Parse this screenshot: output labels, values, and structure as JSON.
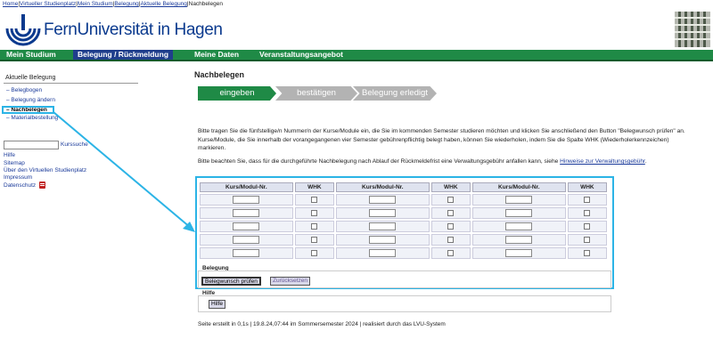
{
  "breadcrumb": {
    "items": [
      "Home",
      "Virtueller Studienplatz",
      "Mein Studium",
      "Belegung",
      "Aktuelle Belegung"
    ],
    "current": "Nachbelegen"
  },
  "header": {
    "logo_text": "FernUniversität in Hagen"
  },
  "topnav": {
    "items": [
      {
        "label": "Mein Studium",
        "active": false
      },
      {
        "label": "Belegung / Rückmeldung",
        "active": true
      },
      {
        "label": "Meine Daten",
        "active": false
      },
      {
        "label": "Veranstaltungsangebot",
        "active": false
      }
    ]
  },
  "sidebar": {
    "title": "Aktuelle Belegung",
    "items": [
      {
        "label": "– Belegbogen"
      },
      {
        "label": "– Belegung ändern"
      },
      {
        "label": "– Nachbelegen",
        "current": true
      },
      {
        "label": "– Materialbestellung"
      }
    ],
    "search_button": "Kurssuche",
    "search_value": "",
    "links": [
      "Hilfe",
      "Sitemap",
      "Über den Virtuellen Studienplatz",
      "Impressum",
      "Datenschutz"
    ]
  },
  "main": {
    "title": "Nachbelegen",
    "steps": [
      "eingeben",
      "bestätigen",
      "Belegung erledigt"
    ],
    "para1": "Bitte tragen Sie die fünfstellige/n Nummer/n der Kurse/Module ein, die Sie im kommenden Semester studieren möchten und klicken Sie anschließend den Button \"Belegwunsch prüfen\" an. Kurse/Module, die Sie innerhalb der vorangegangenen vier Semester gebührenpflichtig belegt haben, können Sie wiederholen, indem Sie die Spalte WHK (Wiederholerkennzeichen) markieren.",
    "para2_text": "Bitte beachten Sie, dass für die durchgeführte Nachbelegung nach Ablauf der Rückmeldefrist eine Verwaltungsgebühr anfallen kann, siehe ",
    "para2_link": "Hinweise zur Verwaltungsgebühr",
    "para2_end": ".",
    "table": {
      "headers": [
        "Kurs/Modul-Nr.",
        "WHK",
        "Kurs/Modul-Nr.",
        "WHK",
        "Kurs/Modul-Nr.",
        "WHK"
      ],
      "rows": 5
    },
    "belegung_label": "Belegung",
    "submit_button": "Belegwunsch prüfen",
    "reset_button": "Zurücksetzen",
    "hilfe_label": "Hilfe",
    "hilfe_button": "Hilfe",
    "footer": "Seite erstellt in 0,1s  |  19.8.24,07:44 im Sommersemester 2024  |  realisiert durch das LVU-System"
  },
  "colors": {
    "nav_green": "#1f8a46",
    "nav_active": "#1f3e8c",
    "highlight": "#2cb4e6",
    "step_inactive": "#b3b3b3"
  }
}
